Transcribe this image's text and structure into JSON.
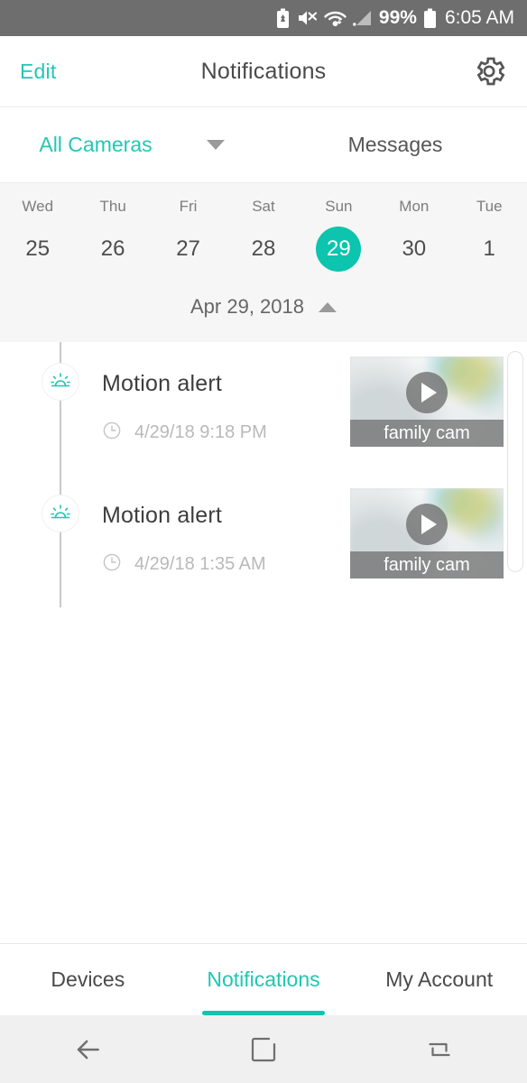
{
  "status_bar": {
    "icons": [
      "battery-saver-icon",
      "mute-icon",
      "wifi-icon",
      "cellular-signal-icon"
    ],
    "battery_percent": "99%",
    "battery_icon": "battery-full-icon",
    "time": "6:05 AM",
    "background": "#6e6e6e"
  },
  "app_bar": {
    "edit_label": "Edit",
    "title": "Notifications",
    "settings_icon": "gear-icon",
    "accent": "#22c8b4"
  },
  "filter_row": {
    "camera_filter": "All Cameras",
    "camera_filter_caret": "chevron-down-icon",
    "messages_label": "Messages"
  },
  "day_strip": {
    "days": [
      {
        "dow": "Wed",
        "num": "25",
        "selected": false
      },
      {
        "dow": "Thu",
        "num": "26",
        "selected": false
      },
      {
        "dow": "Fri",
        "num": "27",
        "selected": false
      },
      {
        "dow": "Sat",
        "num": "28",
        "selected": false
      },
      {
        "dow": "Sun",
        "num": "29",
        "selected": true
      },
      {
        "dow": "Mon",
        "num": "30",
        "selected": false
      },
      {
        "dow": "Tue",
        "num": "1",
        "selected": false
      }
    ],
    "selected_color": "#0dc4ae"
  },
  "date_header": {
    "text": "Apr 29, 2018",
    "caret": "chevron-up-icon"
  },
  "notifications": [
    {
      "icon": "motion-sunrise-icon",
      "title": "Motion alert",
      "clock_icon": "clock-icon",
      "timestamp": "4/29/18 9:18 PM",
      "thumbnail_label": "family cam",
      "play_icon": "play-icon"
    },
    {
      "icon": "motion-sunrise-icon",
      "title": "Motion alert",
      "clock_icon": "clock-icon",
      "timestamp": "4/29/18 1:35 AM",
      "thumbnail_label": "family cam",
      "play_icon": "play-icon"
    }
  ],
  "tab_bar": {
    "tabs": [
      {
        "label": "Devices",
        "active": false
      },
      {
        "label": "Notifications",
        "active": true
      },
      {
        "label": "My Account",
        "active": false
      }
    ],
    "active_color": "#0dc4ae"
  },
  "nav_bar": {
    "back_icon": "back-arrow-icon",
    "home_icon": "home-square-icon",
    "recents_icon": "recent-apps-icon"
  }
}
